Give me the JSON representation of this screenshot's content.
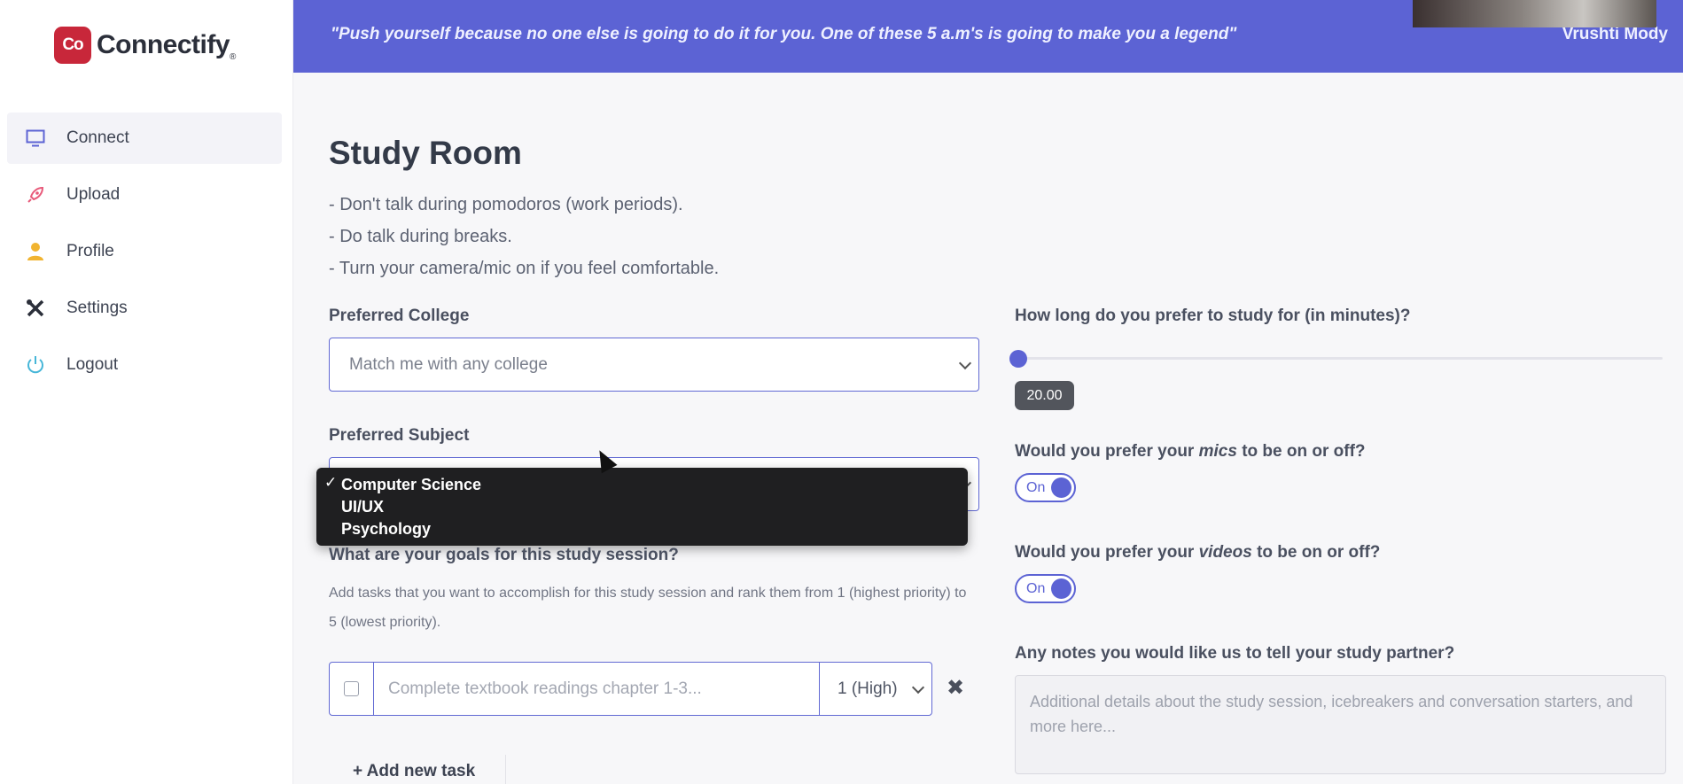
{
  "app": {
    "logo_mark": "Co",
    "logo_text": "Connectify",
    "logo_reg": "®"
  },
  "sidebar": {
    "items": [
      {
        "label": "Connect",
        "icon": "monitor-icon",
        "active": true
      },
      {
        "label": "Upload",
        "icon": "rocket-icon",
        "active": false
      },
      {
        "label": "Profile",
        "icon": "user-icon",
        "active": false
      },
      {
        "label": "Settings",
        "icon": "tools-icon",
        "active": false
      },
      {
        "label": "Logout",
        "icon": "power-icon",
        "active": false
      }
    ]
  },
  "banner": {
    "quote": "\"Push yourself because no one else is going to do it for you. One of these 5 a.m's is going to make you a legend\"",
    "author": "Vrushti Mody"
  },
  "main": {
    "title": "Study Room",
    "rules": [
      "- Don't talk during pomodoros (work periods).",
      "- Do talk during breaks.",
      "- Turn your camera/mic on if you feel comfortable."
    ],
    "college": {
      "label": "Preferred College",
      "value": "Match me with any college"
    },
    "subject": {
      "label": "Preferred Subject",
      "options": [
        "Computer Science",
        "UI/UX",
        "Psychology"
      ],
      "selected": "Computer Science",
      "check": "✓"
    },
    "goals": {
      "label": "What are your goals for this study session?",
      "help": "Add tasks that you want to accomplish for this study session and rank them from 1 (highest priority) to 5 (lowest priority).",
      "task_placeholder": "Complete textbook readings chapter 1-3...",
      "priority": "1 (High)",
      "remove_symbol": "✖",
      "add_label": "+ Add new task"
    }
  },
  "right": {
    "duration": {
      "label": "How long do you prefer to study for (in minutes)?",
      "value": "20.00",
      "slider_fraction": 0.0
    },
    "mics": {
      "label_pre": "Would you prefer your ",
      "label_em": "mics",
      "label_post": " to be on or off?",
      "state": "On"
    },
    "videos": {
      "label_pre": "Would you prefer your ",
      "label_em": "videos",
      "label_post": " to be on or off?",
      "state": "On"
    },
    "notes": {
      "label": "Any notes you would like us to tell your study partner?",
      "placeholder": "Additional details about the study session, icebreakers and conversation starters, and more here..."
    }
  },
  "colors": {
    "accent": "#5c63d4",
    "brand": "#c8273a",
    "sidebar_bg": "#ffffff",
    "dropdown_bg": "#1f1f21"
  }
}
